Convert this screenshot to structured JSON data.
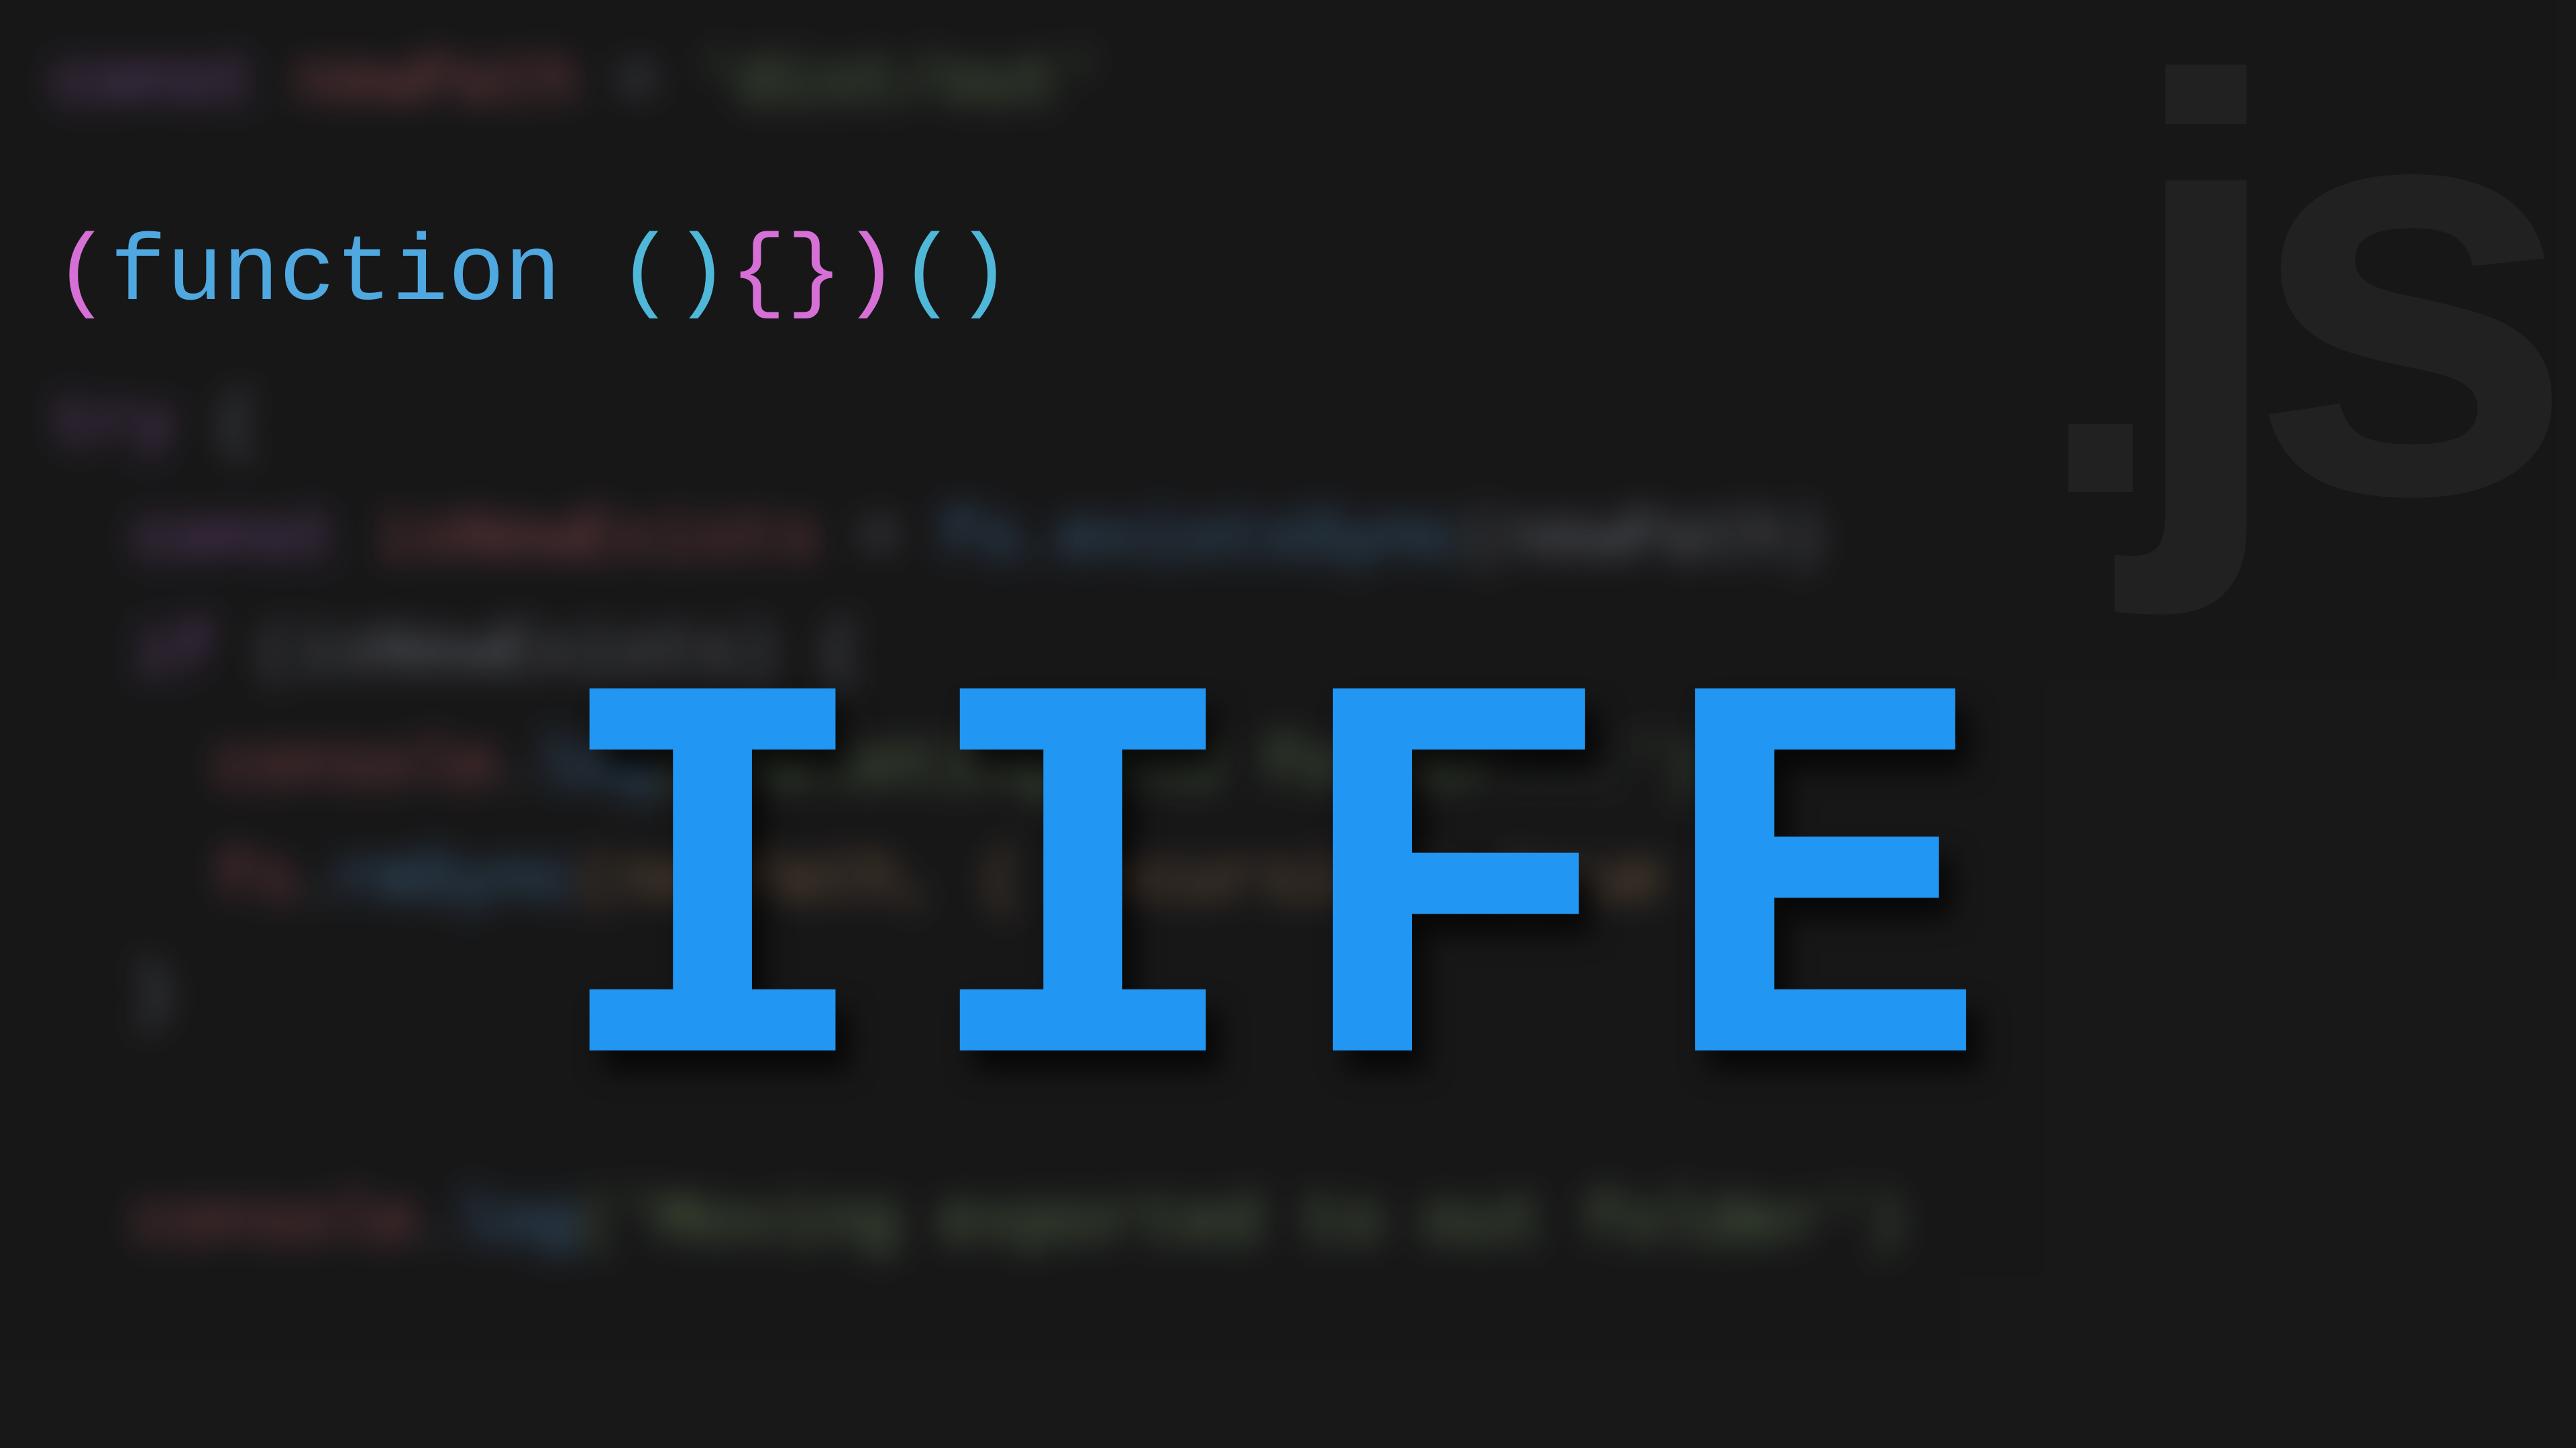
{
  "background": {
    "line1_keyword": "const",
    "line1_var": " newPath",
    "line1_op": " = ",
    "line1_string": "'dist/out'",
    "line2": "",
    "line3_keyword": "try",
    "line3_brace": " {",
    "line4_keyword": "  const",
    "line4_var": " isNewExists",
    "line4_op": " = ",
    "line4_func": "fs.existsSync",
    "line4_paren": "(newPath)",
    "line5_keyword": "  if",
    "line5_cond": " (isNewExists) ",
    "line5_brace": "{",
    "line6_obj": "    console",
    "line6_dot": ".",
    "line6_func": "log",
    "line6_args": "('Deleting old folder...')",
    "line7_obj": "    fs",
    "line7_dot": ".",
    "line7_func": "rmSync",
    "line7_args": "(newPath, { recursive: true })",
    "line8_brace": "  }",
    "line9": "",
    "line10_obj": "  console",
    "line10_dot": ".",
    "line10_func": "log",
    "line10_args": "('Moving exported to out folder')"
  },
  "jsLogo": {
    "dot": ".",
    "text": "js"
  },
  "functionSnippet": {
    "paren_open1": "(",
    "keyword": "function",
    "space1": " ",
    "paren_pair": "()",
    "brace_pair": "{}",
    "paren_close1": ")",
    "paren_pair2": "()"
  },
  "title": "IIFE",
  "colors": {
    "background": "#1a1a1a",
    "primary_blue": "#2196f3",
    "keyword_blue": "#4fa8e0",
    "paren_pink": "#d670d6",
    "paren_cyan": "#4fb8d8"
  }
}
